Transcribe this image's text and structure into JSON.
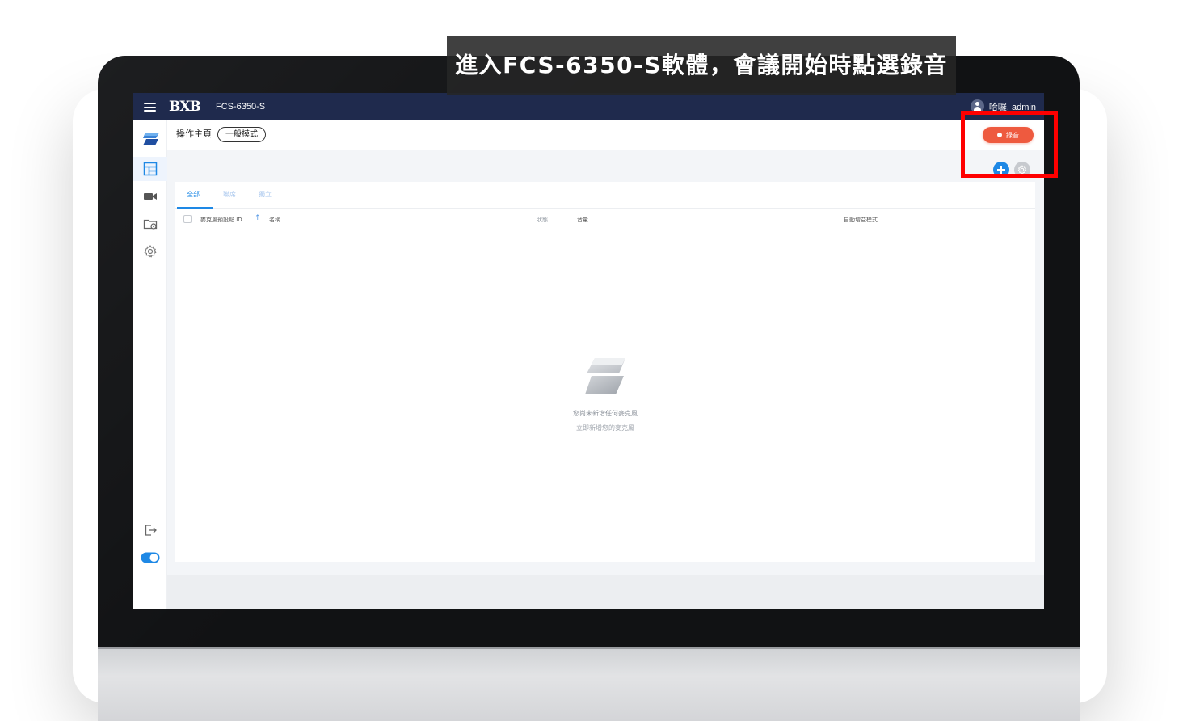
{
  "caption": {
    "text": "進入FCS-6350-S軟體，會議開始時點選錄音"
  },
  "topbar": {
    "logo": "BXB",
    "app_title": "FCS-6350-S",
    "user_name": "哈囉, admin"
  },
  "header": {
    "page_title": "操作主頁",
    "mode_label": "一般模式",
    "record_label": "錄音"
  },
  "tabs": [
    {
      "label": "全部",
      "active": true
    },
    {
      "label": "聯席",
      "active": false
    },
    {
      "label": "獨立",
      "active": false
    }
  ],
  "table": {
    "columns": [
      "麥克風預設點 ID",
      "名稱",
      "狀態",
      "音量",
      "自動增益模式"
    ]
  },
  "empty_state": {
    "title": "您尚未新增任何麥克風",
    "subtitle": "立即新增您的麥克風"
  },
  "sidebar": {
    "icons": [
      "app-logo-icon",
      "dashboard-icon",
      "video-icon",
      "media-folder-icon",
      "gear-icon",
      "logout-icon",
      "toggle-switch"
    ]
  },
  "colors": {
    "topbar": "#1f2a4d",
    "accent": "#1e88e5",
    "record": "#ee5a3f",
    "highlight": "#ff0000"
  }
}
